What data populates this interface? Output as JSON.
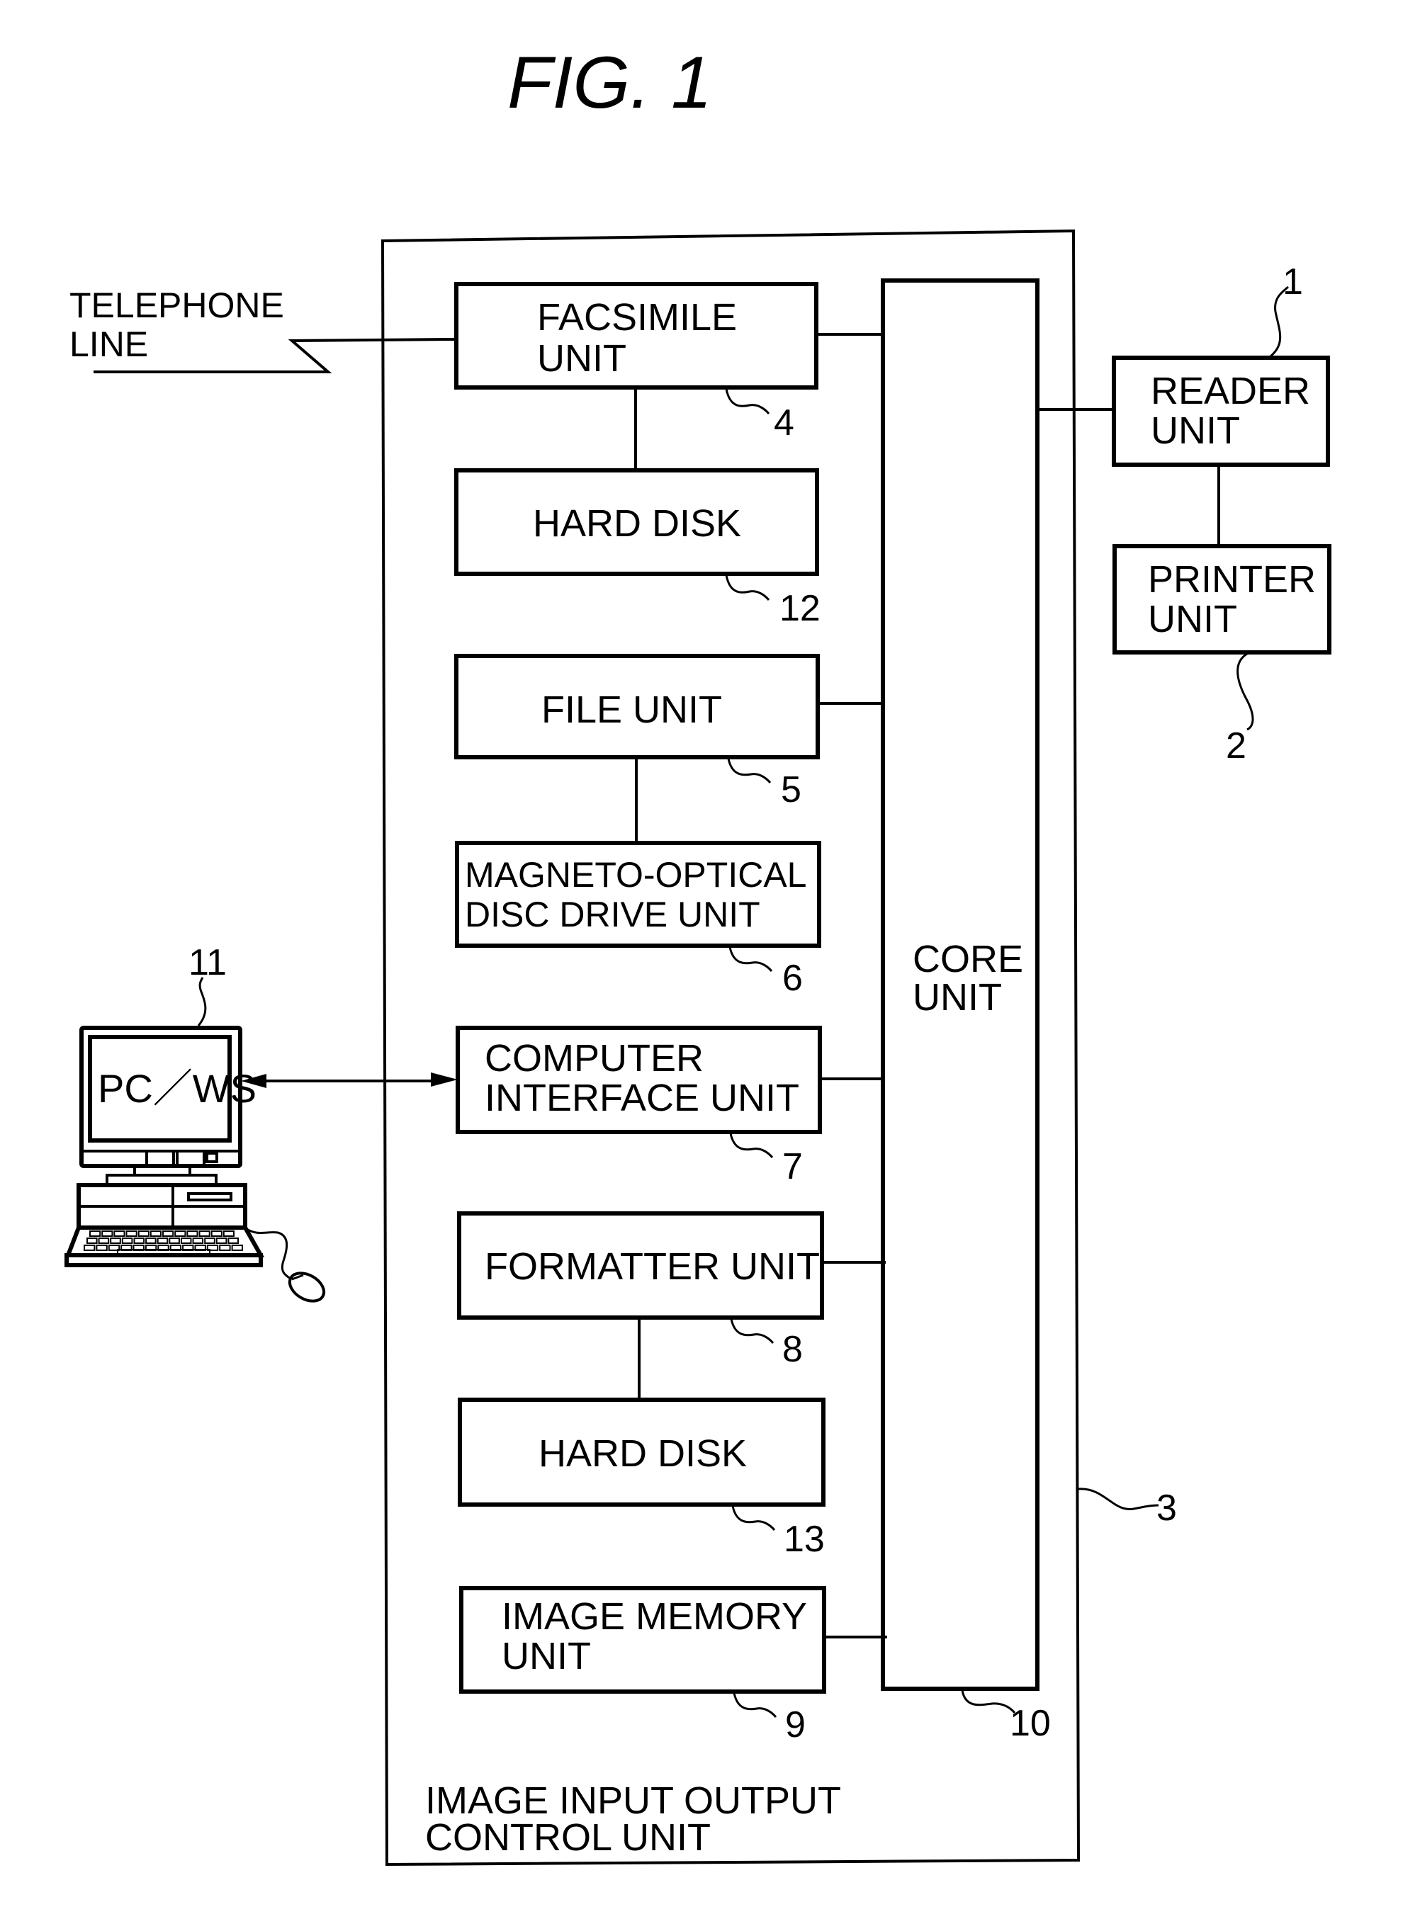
{
  "figure": {
    "title": "FIG.  1"
  },
  "external": {
    "telephone_line": [
      "TELEPHONE",
      "LINE"
    ],
    "pc_ws": {
      "label": "PC／WS",
      "ref": "11"
    },
    "reader_unit": {
      "lines": [
        "READER",
        "UNIT"
      ],
      "ref": "1"
    },
    "printer_unit": {
      "lines": [
        "PRINTER",
        "UNIT"
      ],
      "ref": "2"
    }
  },
  "control_unit": {
    "lines": [
      "IMAGE  INPUT  OUTPUT",
      "CONTROL  UNIT"
    ],
    "ref": "3",
    "core_unit": {
      "lines": [
        "CORE",
        "UNIT"
      ],
      "ref": "10"
    },
    "blocks": [
      {
        "id": "facsimile",
        "lines": [
          "FACSIMILE",
          "UNIT"
        ],
        "ref": "4"
      },
      {
        "id": "hard-disk-12",
        "lines": [
          "HARD  DISK"
        ],
        "ref": "12"
      },
      {
        "id": "file",
        "lines": [
          "FILE  UNIT"
        ],
        "ref": "5"
      },
      {
        "id": "magneto-optical",
        "lines": [
          "MAGNETO-OPTICAL",
          "DISC  DRIVE  UNIT"
        ],
        "ref": "6"
      },
      {
        "id": "computer-interface",
        "lines": [
          "COMPUTER",
          "INTERFACE  UNIT"
        ],
        "ref": "7"
      },
      {
        "id": "formatter",
        "lines": [
          "FORMATTER  UNIT"
        ],
        "ref": "8"
      },
      {
        "id": "hard-disk-13",
        "lines": [
          "HARD  DISK"
        ],
        "ref": "13"
      },
      {
        "id": "image-memory",
        "lines": [
          "IMAGE  MEMORY",
          "UNIT"
        ],
        "ref": "9"
      }
    ]
  }
}
